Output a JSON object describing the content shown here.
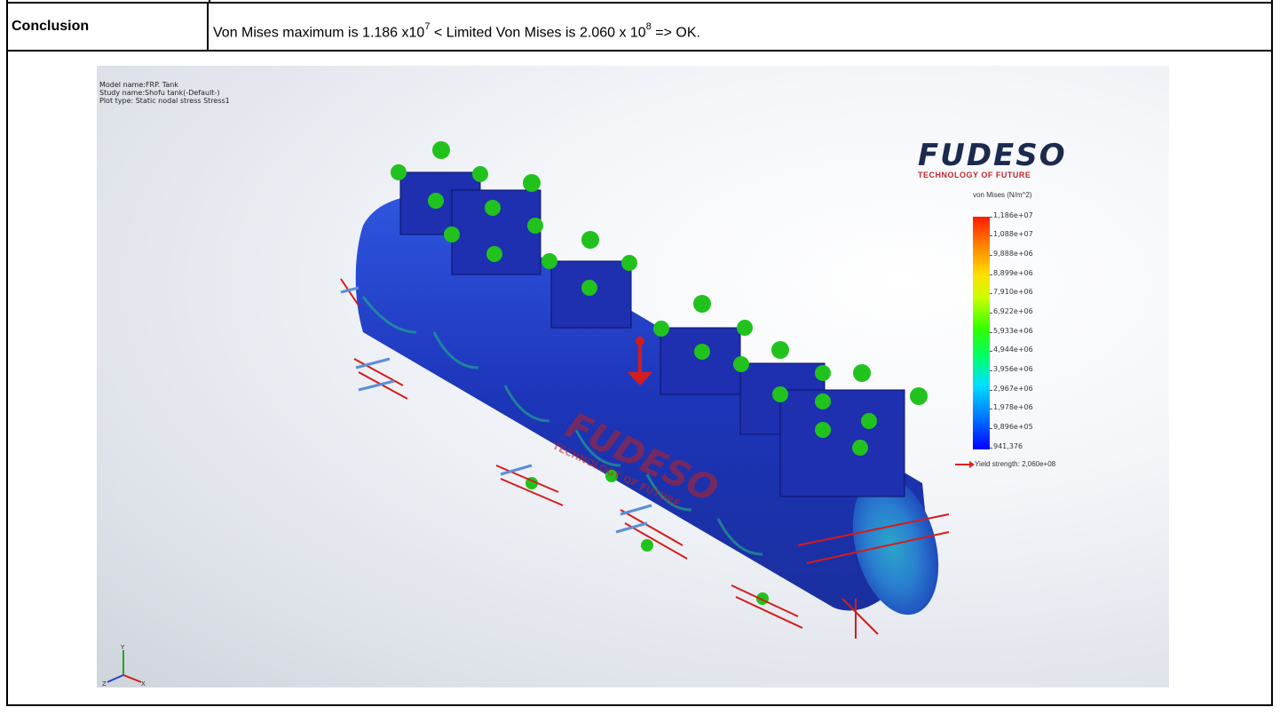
{
  "table": {
    "conclusion_label": "Conclusion",
    "conclusion_text": {
      "part1": "Von Mises maximum is 1.186 x10",
      "exp1": "7",
      "part2": " < Limited Von Mises is 2.060 x 10",
      "exp2": "8",
      "part3": " => OK."
    }
  },
  "figure": {
    "model_name": "Model name:FRP. Tank",
    "study_name": "Study name:Shofu tank(-Default-)",
    "plot_type": "Plot type: Static nodal stress Stress1",
    "logo_word": "FUDESO",
    "logo_tagline": "TECHNOLOGY OF FUTURE",
    "legend_title": "von Mises (N/m^2)",
    "legend_ticks": [
      "1,186e+07",
      "1,088e+07",
      "9,888e+06",
      "8,899e+06",
      "7,910e+06",
      "6,922e+06",
      "5,933e+06",
      "4,944e+06",
      "3,956e+06",
      "2,967e+06",
      "1,978e+06",
      "9,896e+05",
      "941,376"
    ],
    "yield_label": "Yield strength: 2,060e+08",
    "axis_labels": {
      "x": "X",
      "y": "Y",
      "z": "Z"
    },
    "colors": {
      "tank": "#1f3fc4",
      "fixture": "#22c21e",
      "load": "#d41c1c",
      "arrow_blue": "#5b8fd6",
      "brand_red": "#c0282d",
      "brand_navy": "#1c2a4f"
    }
  }
}
